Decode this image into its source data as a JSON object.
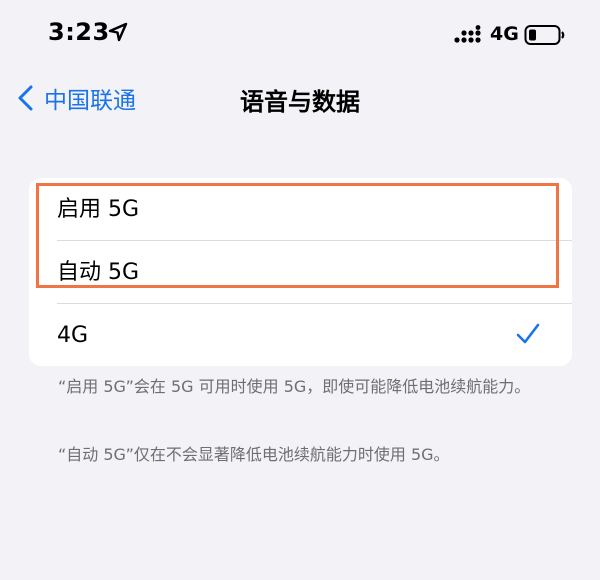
{
  "status_bar": {
    "time": "3:23",
    "network_type": "4G",
    "icons": [
      "location-arrow-icon",
      "cellular-signal-icon",
      "battery-low-icon"
    ]
  },
  "nav": {
    "back_label": "中国联通",
    "title": "语音与数据"
  },
  "options": [
    {
      "label": "启用 5G",
      "selected": false
    },
    {
      "label": "自动 5G",
      "selected": false
    },
    {
      "label": "4G",
      "selected": true
    }
  ],
  "footnotes": [
    "“启用 5G”会在 5G 可用时使用 5G，即使可能降低电池续航能力。",
    "“自动 5G”仅在不会显著降低电池续航能力时使用 5G。"
  ],
  "colors": {
    "accent": "#1a73e8",
    "highlight": "#f07544",
    "background": "#f2f2f7"
  }
}
